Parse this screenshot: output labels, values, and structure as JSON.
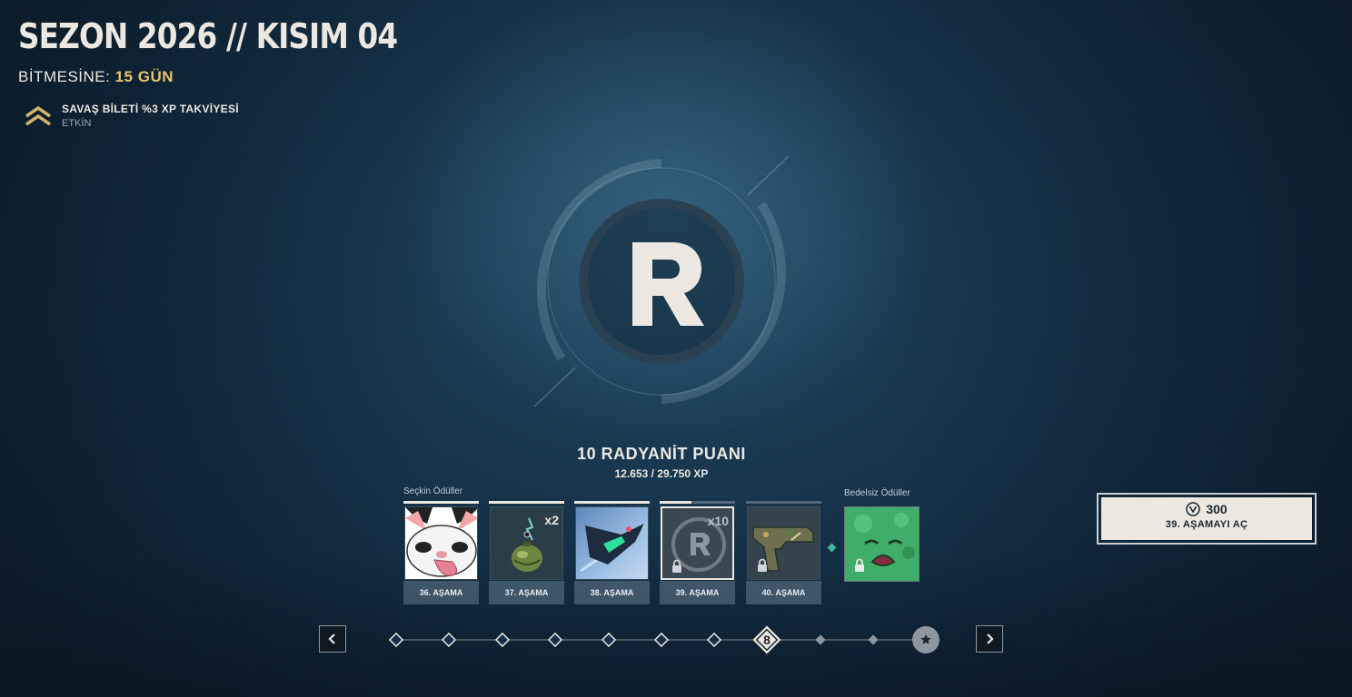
{
  "header": {
    "season_title": "SEZON 2026 // KISIM 04",
    "ends_label": "BİTMESİNE:",
    "ends_value": "15 GÜN"
  },
  "boost": {
    "icon": "chevron-rank-icon",
    "title": "SAVAŞ BİLETİ %3 XP TAKVİYESİ",
    "status": "ETKİN"
  },
  "featured_reward": {
    "icon": "radianite-r-icon",
    "name": "10 RADYANİT PUANI",
    "xp": "12.653 / 29.750 XP"
  },
  "sections": {
    "premium_label": "Seçkin Ödüller",
    "free_label": "Bedelsiz Ödüller"
  },
  "tiers": [
    {
      "label": "36. AŞAMA",
      "icon": "cat-spray-icon",
      "progress": 1.0,
      "locked": false,
      "qty": ""
    },
    {
      "label": "37. AŞAMA",
      "icon": "gun-buddy-icon",
      "progress": 1.0,
      "locked": false,
      "qty": "x2"
    },
    {
      "label": "38. AŞAMA",
      "icon": "player-card-icon",
      "progress": 1.0,
      "locked": false,
      "qty": ""
    },
    {
      "label": "39. AŞAMA",
      "icon": "radianite-icon",
      "progress": 0.42,
      "locked": true,
      "qty": "x10"
    },
    {
      "label": "40. AŞAMA",
      "icon": "pistol-skin-icon",
      "progress": 0.0,
      "locked": true,
      "qty": ""
    }
  ],
  "free_tier": {
    "icon": "slime-spray-icon",
    "locked": true
  },
  "unlock": {
    "price": "300",
    "currency_icon": "valorant-points-icon",
    "label": "39. AŞAMAYI AÇ"
  },
  "track": {
    "current_chapter": "8",
    "end_icon": "star-icon",
    "prev_icon": "chevron-left-icon",
    "next_icon": "chevron-right-icon"
  }
}
